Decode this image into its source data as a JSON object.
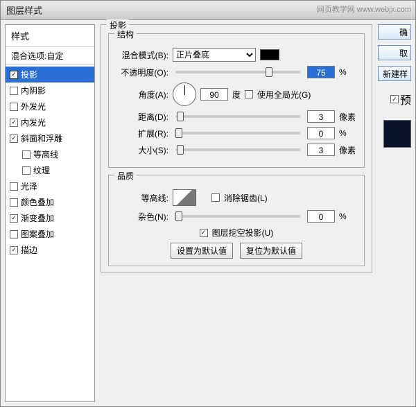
{
  "window": {
    "title": "图层样式",
    "watermark": "网页教学网  www.webjx.com"
  },
  "sidebar": {
    "header": "样式",
    "blend": "混合选项:自定",
    "items": [
      {
        "label": "投影",
        "checked": true,
        "selected": true
      },
      {
        "label": "内阴影",
        "checked": false
      },
      {
        "label": "外发光",
        "checked": false
      },
      {
        "label": "内发光",
        "checked": true
      },
      {
        "label": "斜面和浮雕",
        "checked": true
      },
      {
        "label": "等高线",
        "checked": false,
        "indent": true
      },
      {
        "label": "纹理",
        "checked": false,
        "indent": true
      },
      {
        "label": "光泽",
        "checked": false
      },
      {
        "label": "颜色叠加",
        "checked": false
      },
      {
        "label": "渐变叠加",
        "checked": true
      },
      {
        "label": "图案叠加",
        "checked": false
      },
      {
        "label": "描边",
        "checked": true
      }
    ]
  },
  "panel": {
    "title": "投影",
    "structure": {
      "title": "结构",
      "blendMode": {
        "label": "混合模式(B):",
        "value": "正片叠底"
      },
      "opacity": {
        "label": "不透明度(O):",
        "value": "75",
        "unit": "%"
      },
      "angle": {
        "label": "角度(A):",
        "value": "90",
        "degree": "度",
        "globalLabel": "使用全局光(G)",
        "globalChecked": false
      },
      "distance": {
        "label": "距离(D):",
        "value": "3",
        "unit": "像素"
      },
      "spread": {
        "label": "扩展(R):",
        "value": "0",
        "unit": "%"
      },
      "size": {
        "label": "大小(S):",
        "value": "3",
        "unit": "像素"
      }
    },
    "quality": {
      "title": "品质",
      "contour": {
        "label": "等高线:",
        "antiAliasLabel": "消除锯齿(L)",
        "antiAliasChecked": false
      },
      "noise": {
        "label": "杂色(N):",
        "value": "0",
        "unit": "%"
      },
      "knockout": {
        "label": "图层挖空投影(U)",
        "checked": true
      },
      "setDefault": "设置为默认值",
      "resetDefault": "复位为默认值"
    }
  },
  "buttons": {
    "ok": "确",
    "cancel": "取",
    "newStyle": "新建样",
    "preview": "预",
    "previewChecked": true
  }
}
